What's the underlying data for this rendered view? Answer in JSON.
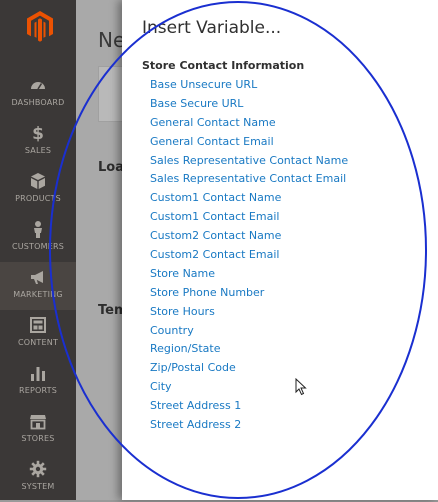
{
  "sidebar": {
    "items": [
      {
        "label": "DASHBOARD",
        "icon": "dashboard-icon"
      },
      {
        "label": "SALES",
        "icon": "dollar-icon"
      },
      {
        "label": "PRODUCTS",
        "icon": "box-icon"
      },
      {
        "label": "CUSTOMERS",
        "icon": "person-icon"
      },
      {
        "label": "MARKETING",
        "icon": "megaphone-icon",
        "active": true
      },
      {
        "label": "CONTENT",
        "icon": "layout-icon"
      },
      {
        "label": "REPORTS",
        "icon": "bar-chart-icon"
      },
      {
        "label": "STORES",
        "icon": "storefront-icon"
      },
      {
        "label": "SYSTEM",
        "icon": "gear-icon"
      }
    ]
  },
  "background": {
    "title": "Ne",
    "label_load": "Loa",
    "label_tem": "Tem"
  },
  "modal": {
    "title": "Insert Variable...",
    "section": "Store Contact Information",
    "variables": [
      "Base Unsecure URL",
      "Base Secure URL",
      "General Contact Name",
      "General Contact Email",
      "Sales Representative Contact Name",
      "Sales Representative Contact Email",
      "Custom1 Contact Name",
      "Custom1 Contact Email",
      "Custom2 Contact Name",
      "Custom2 Contact Email",
      "Store Name",
      "Store Phone Number",
      "Store Hours",
      "Country",
      "Region/State",
      "Zip/Postal Code",
      "City",
      "Street Address 1",
      "Street Address 2"
    ]
  },
  "colors": {
    "sidebar_bg": "#3b3837",
    "logo": "#eb5202",
    "link": "#1979c3",
    "annotation": "#1a2fd0"
  }
}
